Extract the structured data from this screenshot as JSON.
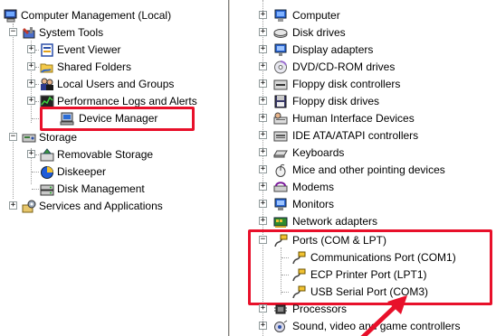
{
  "left_tree": {
    "root": "Computer Management (Local)",
    "system_tools": "System Tools",
    "event_viewer": "Event Viewer",
    "shared_folders": "Shared Folders",
    "local_users": "Local Users and Groups",
    "performance_logs": "Performance Logs and Alerts",
    "device_manager": "Device Manager",
    "storage": "Storage",
    "removable_storage": "Removable Storage",
    "diskeeper": "Diskeeper",
    "disk_management": "Disk Management",
    "services_apps": "Services and Applications"
  },
  "device_tree": {
    "computer": "Computer",
    "disk_drives": "Disk drives",
    "display_adapters": "Display adapters",
    "dvd_cdrom": "DVD/CD-ROM drives",
    "floppy_controllers": "Floppy disk controllers",
    "floppy_drives": "Floppy disk drives",
    "hid": "Human Interface Devices",
    "ide": "IDE ATA/ATAPI controllers",
    "keyboards": "Keyboards",
    "mice": "Mice and other pointing devices",
    "modems": "Modems",
    "monitors": "Monitors",
    "network_adapters": "Network adapters",
    "ports": "Ports (COM & LPT)",
    "com1": "Communications Port (COM1)",
    "lpt1": "ECP Printer Port (LPT1)",
    "com3": "USB Serial Port (COM3)",
    "processors": "Processors",
    "sound": "Sound, video and game controllers"
  },
  "expander": {
    "plus": "+",
    "minus": "−"
  },
  "colors": {
    "highlight": "#e8102a",
    "tree_line": "#a0a0a0"
  }
}
